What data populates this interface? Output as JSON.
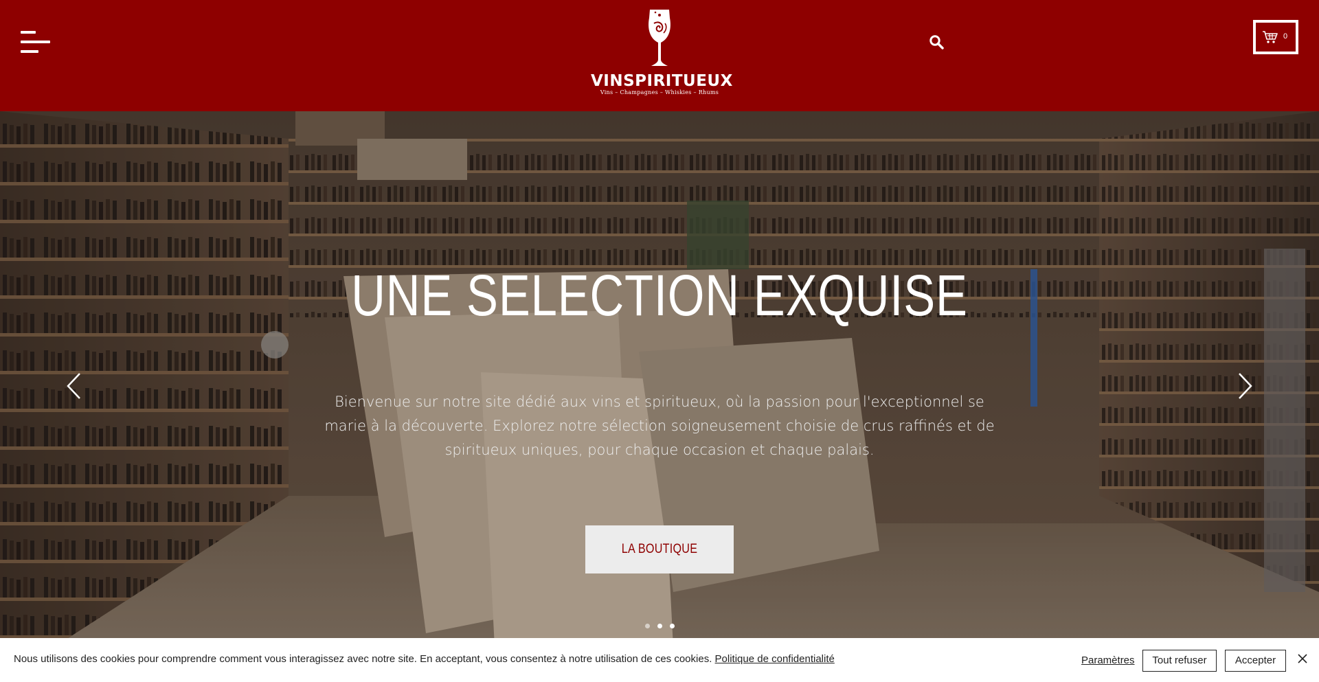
{
  "header": {
    "brand_name": "VINSPIRITUEUX",
    "brand_tagline": "Vins – Champagnes – Whiskies – Rhums",
    "cart_count": "0",
    "background_color": "#8e0000",
    "icons": [
      "menu-icon",
      "search-icon",
      "cart-icon"
    ]
  },
  "hero": {
    "title": "UNE SELECTION EXQUISE",
    "description": "Bienvenue sur notre site dédié aux vins et spiritueux, où la passion pour l'exceptionnel se marie à la découverte. Explorez notre sélection soigneusement choisie de crus raffinés et de spiritueux uniques, pour chaque occasion et chaque palais.",
    "button_label": "LA BOUTIQUE",
    "slides_total": 3,
    "active_slide": 3
  },
  "cookie_banner": {
    "message": "Nous utilisons des cookies pour comprendre comment vous interagissez avec notre site. En acceptant, vous consentez à notre utilisation de ces cookies.",
    "privacy_link": "Politique de confidentialité",
    "settings_label": "Paramètres",
    "refuse_label": "Tout refuser",
    "accept_label": "Accepter"
  }
}
